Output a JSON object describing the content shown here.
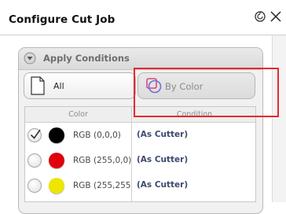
{
  "dialog": {
    "title": "Configure Cut Job",
    "icons": [
      "refresh-icon",
      "close-icon"
    ]
  },
  "panel": {
    "title": "Apply Conditions",
    "toggle_all_label": "All",
    "toggle_color_label": "By Color"
  },
  "table": {
    "columns": [
      "Color",
      "Condition"
    ],
    "rows": [
      {
        "rgb": "RGB (0,0,0)",
        "condition": "(As Cutter)",
        "swatch": "#000000",
        "checked": true
      },
      {
        "rgb": "RGB (255,0,0)",
        "condition": "(As Cutter)",
        "swatch": "#e0000b",
        "checked": false
      },
      {
        "rgb": "RGB (255,255,0)",
        "condition": "(As Cutter)",
        "swatch": "#ece600",
        "checked": false
      }
    ]
  },
  "colors": {
    "highlight": "#e8282e",
    "condition_text": "#3e4a6e"
  }
}
